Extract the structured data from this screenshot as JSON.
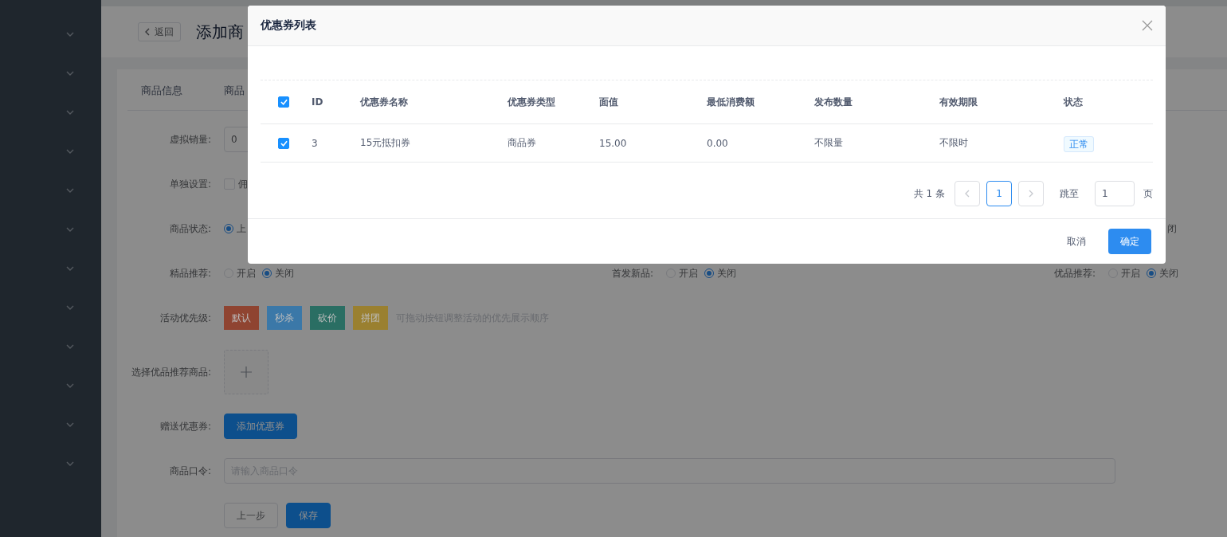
{
  "sidebar": {
    "items": [
      {
        "expanded": false
      },
      {
        "expanded": false
      },
      {
        "expanded": false
      },
      {
        "expanded": false
      },
      {
        "expanded": false
      },
      {
        "expanded": false
      },
      {
        "expanded": false
      },
      {
        "expanded": false
      },
      {
        "expanded": false
      },
      {
        "expanded": false
      },
      {
        "expanded": false
      },
      {
        "expanded": false
      }
    ]
  },
  "header": {
    "back_button": "返回",
    "title": "添加商"
  },
  "form_tabs": [
    "商品信息",
    "商品"
  ],
  "form": {
    "virtual_sales": {
      "label": "虚拟销量:",
      "value": "0"
    },
    "separate_setting": {
      "label": "单独设置:",
      "options": [
        {
          "label": "佣",
          "checked": false
        }
      ]
    },
    "product_status": {
      "label": "商品状态:",
      "options": [
        {
          "label": "上",
          "selected": true
        }
      ],
      "right_fragment": "闭"
    },
    "toggle_groups": [
      {
        "label": "精品推荐:",
        "options": [
          {
            "label": "开启",
            "selected": false
          },
          {
            "label": "关闭",
            "selected": true
          }
        ]
      },
      {
        "label": "首发新品:",
        "options": [
          {
            "label": "开启",
            "selected": false
          },
          {
            "label": "关闭",
            "selected": true
          }
        ]
      },
      {
        "label": "优品推荐:",
        "options": [
          {
            "label": "开启",
            "selected": false
          },
          {
            "label": "关闭",
            "selected": true
          }
        ]
      }
    ],
    "activity_priority": {
      "label": "活动优先级:",
      "buttons": [
        {
          "label": "默认",
          "color": "#8f4431"
        },
        {
          "label": "秒杀",
          "color": "#3b78a8"
        },
        {
          "label": "砍价",
          "color": "#2a6e63"
        },
        {
          "label": "拼团",
          "color": "#9a8030"
        }
      ],
      "hint": "可拖动按钮调整活动的优先展示顺序"
    },
    "recommended_products": {
      "label": "选择优品推荐商品:"
    },
    "gift_coupons": {
      "label": "赠送优惠券:",
      "button": "添加优惠券"
    },
    "product_password": {
      "label": "商品口令:",
      "placeholder": "请输入商品口令"
    },
    "actions": [
      "上一步",
      "保存"
    ]
  },
  "dialog": {
    "title": "优惠券列表",
    "table": {
      "all_checked": true,
      "columns": [
        "ID",
        "优惠券名称",
        "优惠券类型",
        "面值",
        "最低消费额",
        "发布数量",
        "有效期限",
        "状态"
      ],
      "rows": [
        {
          "checked": true,
          "cells": [
            "3",
            "15元抵扣券",
            "商品券",
            "15.00",
            "0.00",
            "不限量",
            "不限时"
          ],
          "status": "正常"
        }
      ]
    },
    "pagination": {
      "total": "共 1 条",
      "pages": [
        {
          "label": "1",
          "selected": true
        }
      ],
      "jump_label": "跳至",
      "jump_value": "1",
      "page_suffix": "页"
    },
    "cancel": "取消",
    "confirm": "确定"
  }
}
